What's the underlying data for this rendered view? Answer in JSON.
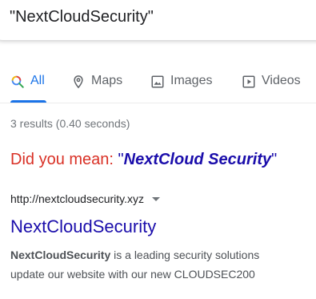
{
  "search": {
    "query": "\"NextCloudSecurity\""
  },
  "tabs": [
    {
      "label": "All",
      "icon": "search-icon",
      "active": true
    },
    {
      "label": "Maps",
      "icon": "map-pin-icon",
      "active": false
    },
    {
      "label": "Images",
      "icon": "image-icon",
      "active": false
    },
    {
      "label": "Videos",
      "icon": "video-icon",
      "active": false
    }
  ],
  "stats": {
    "text": "3 results (0.40 seconds)"
  },
  "spelling": {
    "prefix": "Did you mean: ",
    "open_quote": "\"",
    "suggestion": "NextCloud Security",
    "close_quote": "\""
  },
  "result": {
    "url": "http://nextcloudsecurity.xyz",
    "title": "NextCloudSecurity",
    "snippet_bold": "NextCloudSecurity",
    "snippet_rest_line1": " is a leading security solutions",
    "snippet_line2": "update our website with our new CLOUDSEC200"
  },
  "colors": {
    "accent": "#1a73e8",
    "link": "#1a0dab",
    "did_you_mean": "#d93025",
    "muted": "#70757a"
  }
}
